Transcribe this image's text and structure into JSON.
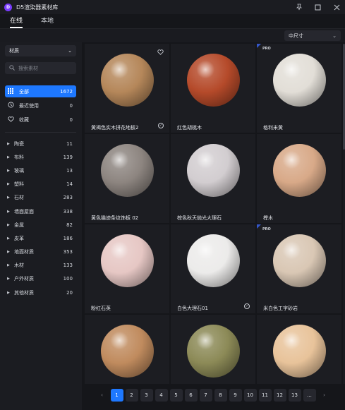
{
  "app": {
    "title": "D5渲染器素材库",
    "logo_letter": "D"
  },
  "tabs": [
    {
      "label": "在线",
      "active": true
    },
    {
      "label": "本地",
      "active": false
    }
  ],
  "size_select": {
    "value": "中尺寸"
  },
  "sidebar": {
    "material_select": {
      "value": "材质"
    },
    "search": {
      "placeholder": "搜索素材"
    },
    "quick": [
      {
        "label": "全部",
        "count": "1672",
        "icon": "grid-icon",
        "active": true
      },
      {
        "label": "最近使用",
        "count": "0",
        "icon": "clock-icon",
        "active": false
      },
      {
        "label": "收藏",
        "count": "0",
        "icon": "heart-icon",
        "active": false
      }
    ],
    "categories": [
      {
        "label": "陶瓷",
        "count": "11"
      },
      {
        "label": "布料",
        "count": "139"
      },
      {
        "label": "玻璃",
        "count": "13"
      },
      {
        "label": "塑料",
        "count": "14"
      },
      {
        "label": "石材",
        "count": "283"
      },
      {
        "label": "墙面屋面",
        "count": "338"
      },
      {
        "label": "金属",
        "count": "82"
      },
      {
        "label": "皮革",
        "count": "186"
      },
      {
        "label": "地面材质",
        "count": "353"
      },
      {
        "label": "木材",
        "count": "133"
      },
      {
        "label": "户外材质",
        "count": "100"
      },
      {
        "label": "其他材质",
        "count": "20"
      }
    ]
  },
  "materials": [
    {
      "label": "黄褐色实木拼花地板2",
      "pro": false,
      "favorite": true,
      "downloaded": true,
      "color": "#b5875a"
    },
    {
      "label": "红色胡桃木",
      "pro": false,
      "favorite": false,
      "downloaded": false,
      "color": "#b54a2a"
    },
    {
      "label": "格利米黄",
      "pro": true,
      "favorite": false,
      "downloaded": false,
      "color": "#e2ded7"
    },
    {
      "label": "黄色猫迹条纹饰板 02",
      "pro": false,
      "favorite": false,
      "downloaded": false,
      "color": "#8d8580"
    },
    {
      "label": "棕色秋天抛光大理石",
      "pro": false,
      "favorite": false,
      "downloaded": false,
      "color": "#d2cdd0"
    },
    {
      "label": "榉木",
      "pro": false,
      "favorite": false,
      "downloaded": false,
      "color": "#d8a988"
    },
    {
      "label": "粉红石英",
      "pro": false,
      "favorite": false,
      "downloaded": false,
      "color": "#e6c7c4"
    },
    {
      "label": "白色大理石01",
      "pro": false,
      "favorite": false,
      "downloaded": true,
      "color": "#ecebea"
    },
    {
      "label": "米白色工字砂岩",
      "pro": true,
      "favorite": false,
      "downloaded": false,
      "color": "#d9c7b4"
    },
    {
      "label": "",
      "pro": false,
      "favorite": false,
      "downloaded": false,
      "color": "#c08b5e"
    },
    {
      "label": "",
      "pro": false,
      "favorite": false,
      "downloaded": false,
      "color": "#8c8a57"
    },
    {
      "label": "",
      "pro": false,
      "favorite": false,
      "downloaded": false,
      "color": "#e8c39a"
    }
  ],
  "pagination": {
    "prev": "‹",
    "next": "›",
    "pages": [
      "1",
      "2",
      "3",
      "4",
      "5",
      "6",
      "7",
      "8",
      "9",
      "10",
      "11",
      "12",
      "13",
      "..."
    ],
    "current": "1"
  },
  "colors": {
    "accent": "#1e78ff",
    "background": "#15161a",
    "panel": "#1b1c21"
  }
}
